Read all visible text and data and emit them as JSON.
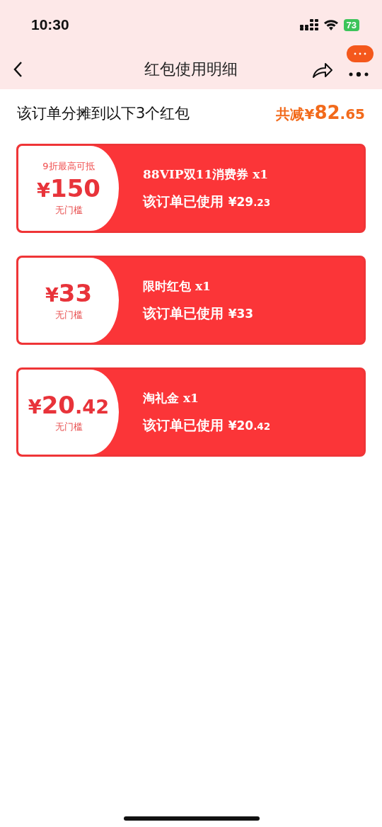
{
  "status_bar": {
    "time": "10:30",
    "battery": "73"
  },
  "nav": {
    "title": "红包使用明细"
  },
  "summary": {
    "text": "该订单分摊到以下3个红包",
    "total_label": "共减",
    "total_symbol": "¥",
    "total_main": "82",
    "total_fraction": ".65"
  },
  "coupons": [
    {
      "note": "9折最高可抵",
      "symbol": "¥",
      "amount_main": "150",
      "threshold": "无门槛",
      "name": "88VIP双11消费券",
      "count": "x1",
      "used_label": "该订单已使用",
      "used_symbol": "¥",
      "used_main": "29",
      "used_fraction": ".23"
    },
    {
      "symbol": "¥",
      "amount_main": "33",
      "threshold": "无门槛",
      "name": "限时红包",
      "count": "x1",
      "used_label": "该订单已使用",
      "used_symbol": "¥",
      "used_main": "33"
    },
    {
      "symbol": "¥",
      "amount_main": "20",
      "amount_fraction": ".42",
      "threshold": "无门槛",
      "name": "淘礼金",
      "count": "x1",
      "used_label": "该订单已使用",
      "used_symbol": "¥",
      "used_main": "20",
      "used_fraction": ".42"
    }
  ]
}
